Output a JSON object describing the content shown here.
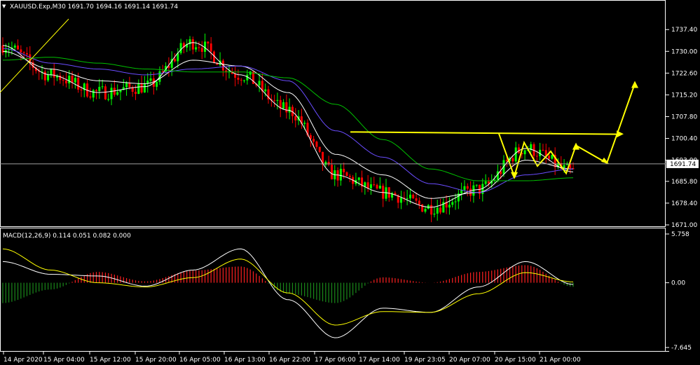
{
  "window": {
    "menu_arrow": "triangle-down-icon",
    "symbol_header": "XAUUSD.Exp,M30  1691.70 1694.16 1691.14 1691.74"
  },
  "colors": {
    "background": "#000000",
    "grid": "#ffffff",
    "bull": "#00ff00",
    "bear": "#ff0000",
    "ma_fast": "#ffffff",
    "ma_mid": "#6a4cff",
    "ma_slow": "#00c000",
    "ma_yellow": "#ffff00",
    "annotation": "#ffff00",
    "macd_pos": "#ff2020",
    "macd_neg": "#1a8a1a",
    "macd_line": "#ffffff",
    "signal_line": "#ffff00"
  },
  "price_panel": {
    "current_price_label": "1691.74",
    "ylim": [
      1671.0,
      1741.5
    ],
    "y_ticks": [
      "1737.40",
      "1730.00",
      "1722.60",
      "1715.20",
      "1707.80",
      "1700.40",
      "1693.00",
      "1685.80",
      "1678.40",
      "1671.00"
    ],
    "y_tick_values": [
      1737.4,
      1730.0,
      1722.6,
      1715.2,
      1707.8,
      1700.4,
      1693.0,
      1685.8,
      1678.4,
      1671.0
    ]
  },
  "macd_panel": {
    "header": "MACD(12,26,9) 0.114 0.051 0.082 0.000",
    "ylim": [
      -7.645,
      5.758
    ],
    "y_ticks": [
      "5.758",
      "0.00",
      "-7.645"
    ],
    "y_tick_values": [
      5.758,
      0.0,
      -7.645
    ]
  },
  "x_axis": {
    "labels": [
      "14 Apr 2020",
      "15 Apr 04:00",
      "15 Apr 12:00",
      "15 Apr 20:00",
      "16 Apr 05:00",
      "16 Apr 13:00",
      "16 Apr 22:00",
      "17 Apr 06:00",
      "17 Apr 14:00",
      "19 Apr 23:05",
      "20 Apr 07:00",
      "20 Apr 15:00",
      "21 Apr 00:00"
    ]
  },
  "chart_data": {
    "type": "line",
    "symbol": "XAUUSD.Exp",
    "timeframe": "M30",
    "x": [
      "14 Apr 2020",
      "15 Apr 04:00",
      "15 Apr 12:00",
      "15 Apr 20:00",
      "16 Apr 05:00",
      "16 Apr 13:00",
      "16 Apr 22:00",
      "17 Apr 06:00",
      "17 Apr 14:00",
      "19 Apr 23:05",
      "20 Apr 07:00",
      "20 Apr 15:00",
      "21 Apr 00:00"
    ],
    "series": [
      {
        "values": [
          1732,
          1722,
          1716,
          1718,
          1733,
          1722,
          1710,
          1688,
          1682,
          1677,
          1683,
          1697,
          1689
        ]
      },
      {
        "values": [
          1730,
          1724,
          1720,
          1719,
          1727,
          1725,
          1716,
          1695,
          1688,
          1680,
          1682,
          1693,
          1690
        ]
      },
      {
        "values": [
          1731,
          1726,
          1724,
          1722,
          1724,
          1725,
          1720,
          1703,
          1694,
          1685,
          1682,
          1688,
          1690
        ]
      },
      {
        "values": [
          1727,
          1728,
          1726,
          1724,
          1723,
          1723,
          1721,
          1712,
          1700,
          1690,
          1686,
          1686,
          1687
        ]
      }
    ],
    "macd": {
      "values": [
        2.5,
        1.0,
        0.8,
        -0.4,
        1.5,
        4.0,
        -2.0,
        -6.5,
        -3.0,
        -3.5,
        -0.5,
        2.5,
        -0.2
      ],
      "signal": [
        4.0,
        1.5,
        0.0,
        -0.5,
        0.6,
        2.8,
        -1.2,
        -5.0,
        -3.4,
        -3.5,
        -1.3,
        1.2,
        0.1
      ],
      "ylim": [
        -7.645,
        5.758
      ]
    },
    "ylim": [
      1671.0,
      1741.5
    ],
    "grid": false,
    "annotations": [
      "resistance line ~1702.5",
      "zigzag projection arrows"
    ]
  }
}
